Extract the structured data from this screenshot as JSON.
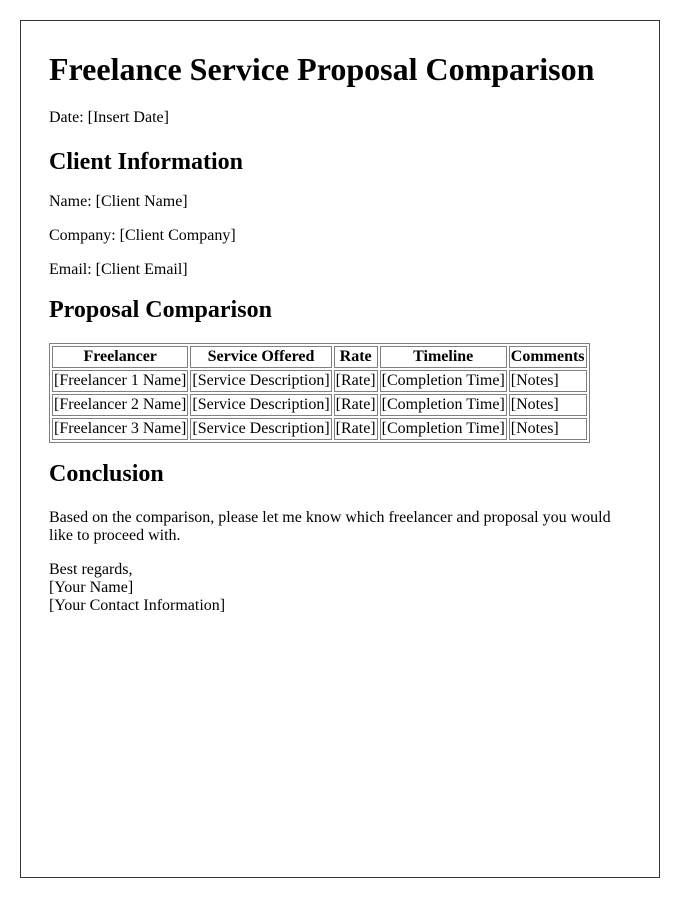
{
  "document": {
    "title": "Freelance Service Proposal Comparison",
    "date_line": "Date: [Insert Date]"
  },
  "client_info": {
    "heading": "Client Information",
    "name_line": "Name: [Client Name]",
    "company_line": "Company: [Client Company]",
    "email_line": "Email: [Client Email]"
  },
  "proposal": {
    "heading": "Proposal Comparison",
    "table": {
      "headers": [
        "Freelancer",
        "Service Offered",
        "Rate",
        "Timeline",
        "Comments"
      ],
      "rows": [
        [
          "[Freelancer 1 Name]",
          "[Service Description]",
          "[Rate]",
          "[Completion Time]",
          "[Notes]"
        ],
        [
          "[Freelancer 2 Name]",
          "[Service Description]",
          "[Rate]",
          "[Completion Time]",
          "[Notes]"
        ],
        [
          "[Freelancer 3 Name]",
          "[Service Description]",
          "[Rate]",
          "[Completion Time]",
          "[Notes]"
        ]
      ]
    }
  },
  "conclusion": {
    "heading": "Conclusion",
    "text": "Based on the comparison, please let me know which freelancer and proposal you would like to proceed with.",
    "signoff": [
      "Best regards,",
      "[Your Name]",
      "[Your Contact Information]"
    ]
  }
}
